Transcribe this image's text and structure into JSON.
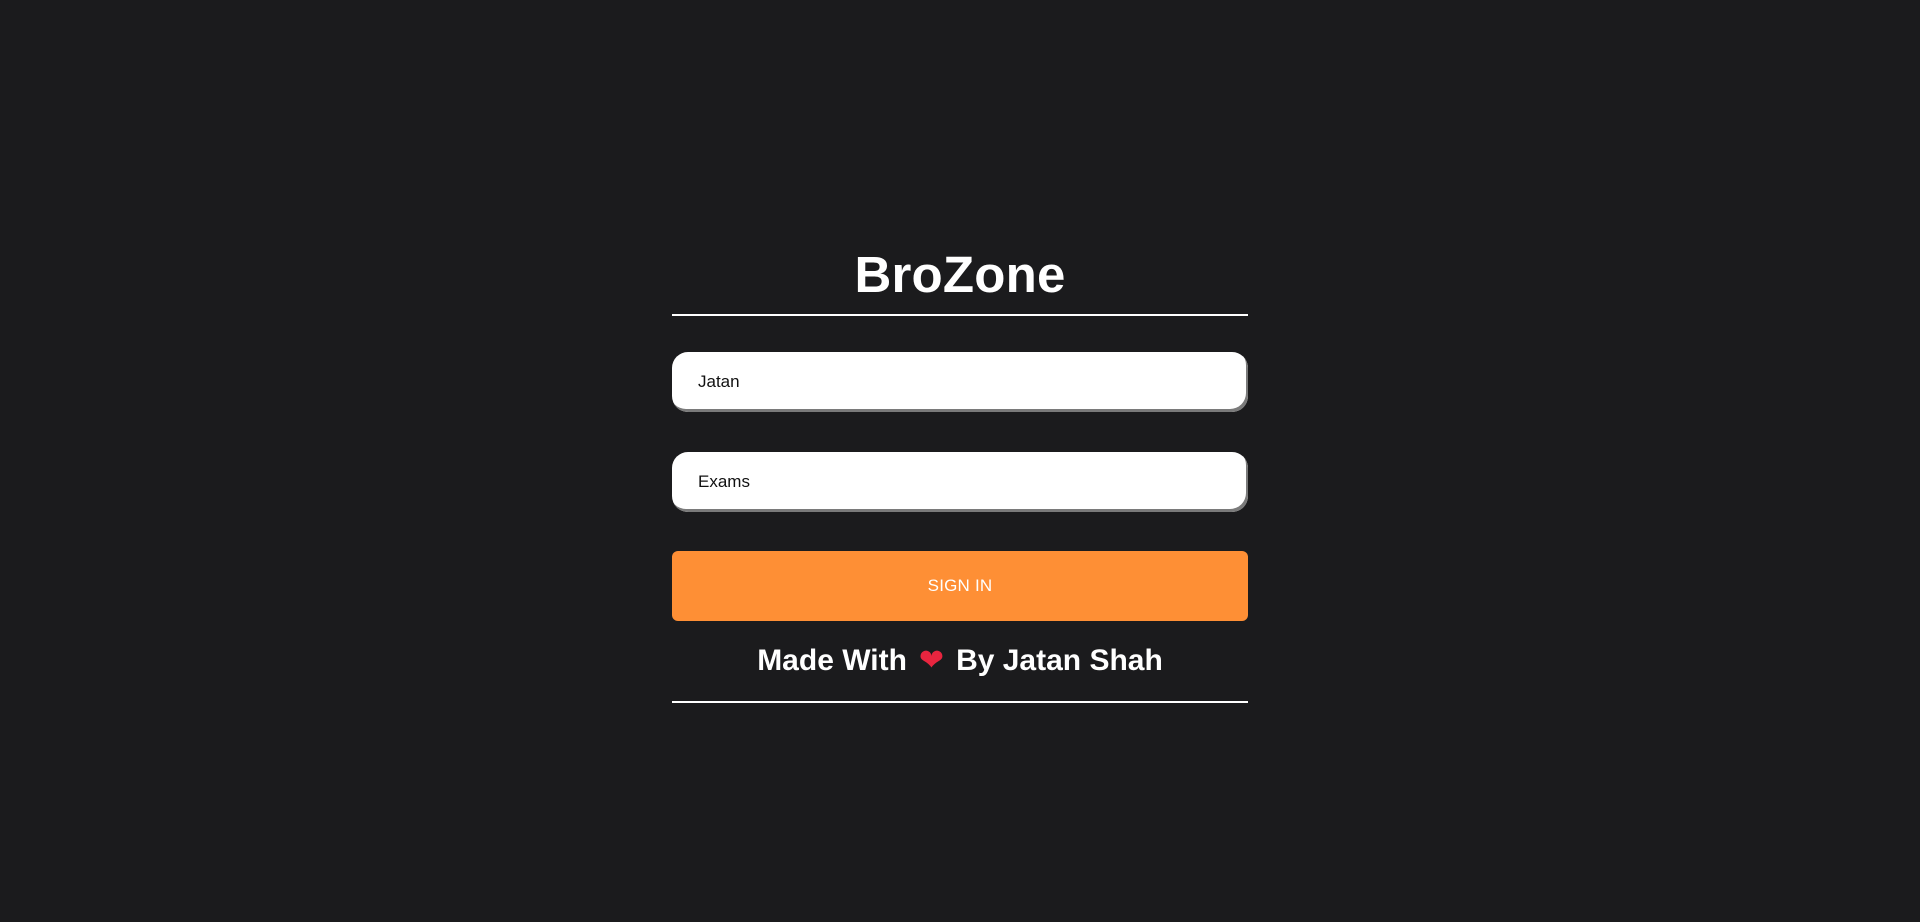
{
  "app": {
    "title": "BroZone"
  },
  "form": {
    "username_value": "Jatan",
    "password_value": "Exams",
    "signin_label": "SIGN IN"
  },
  "footer": {
    "made_with": "Made With",
    "heart_icon": "heart-icon",
    "heart_glyph": "❤",
    "by_author": "By Jatan Shah"
  },
  "colors": {
    "background": "#1b1b1d",
    "accent": "#fe8f35",
    "heart": "#e8253f",
    "text": "#ffffff"
  }
}
